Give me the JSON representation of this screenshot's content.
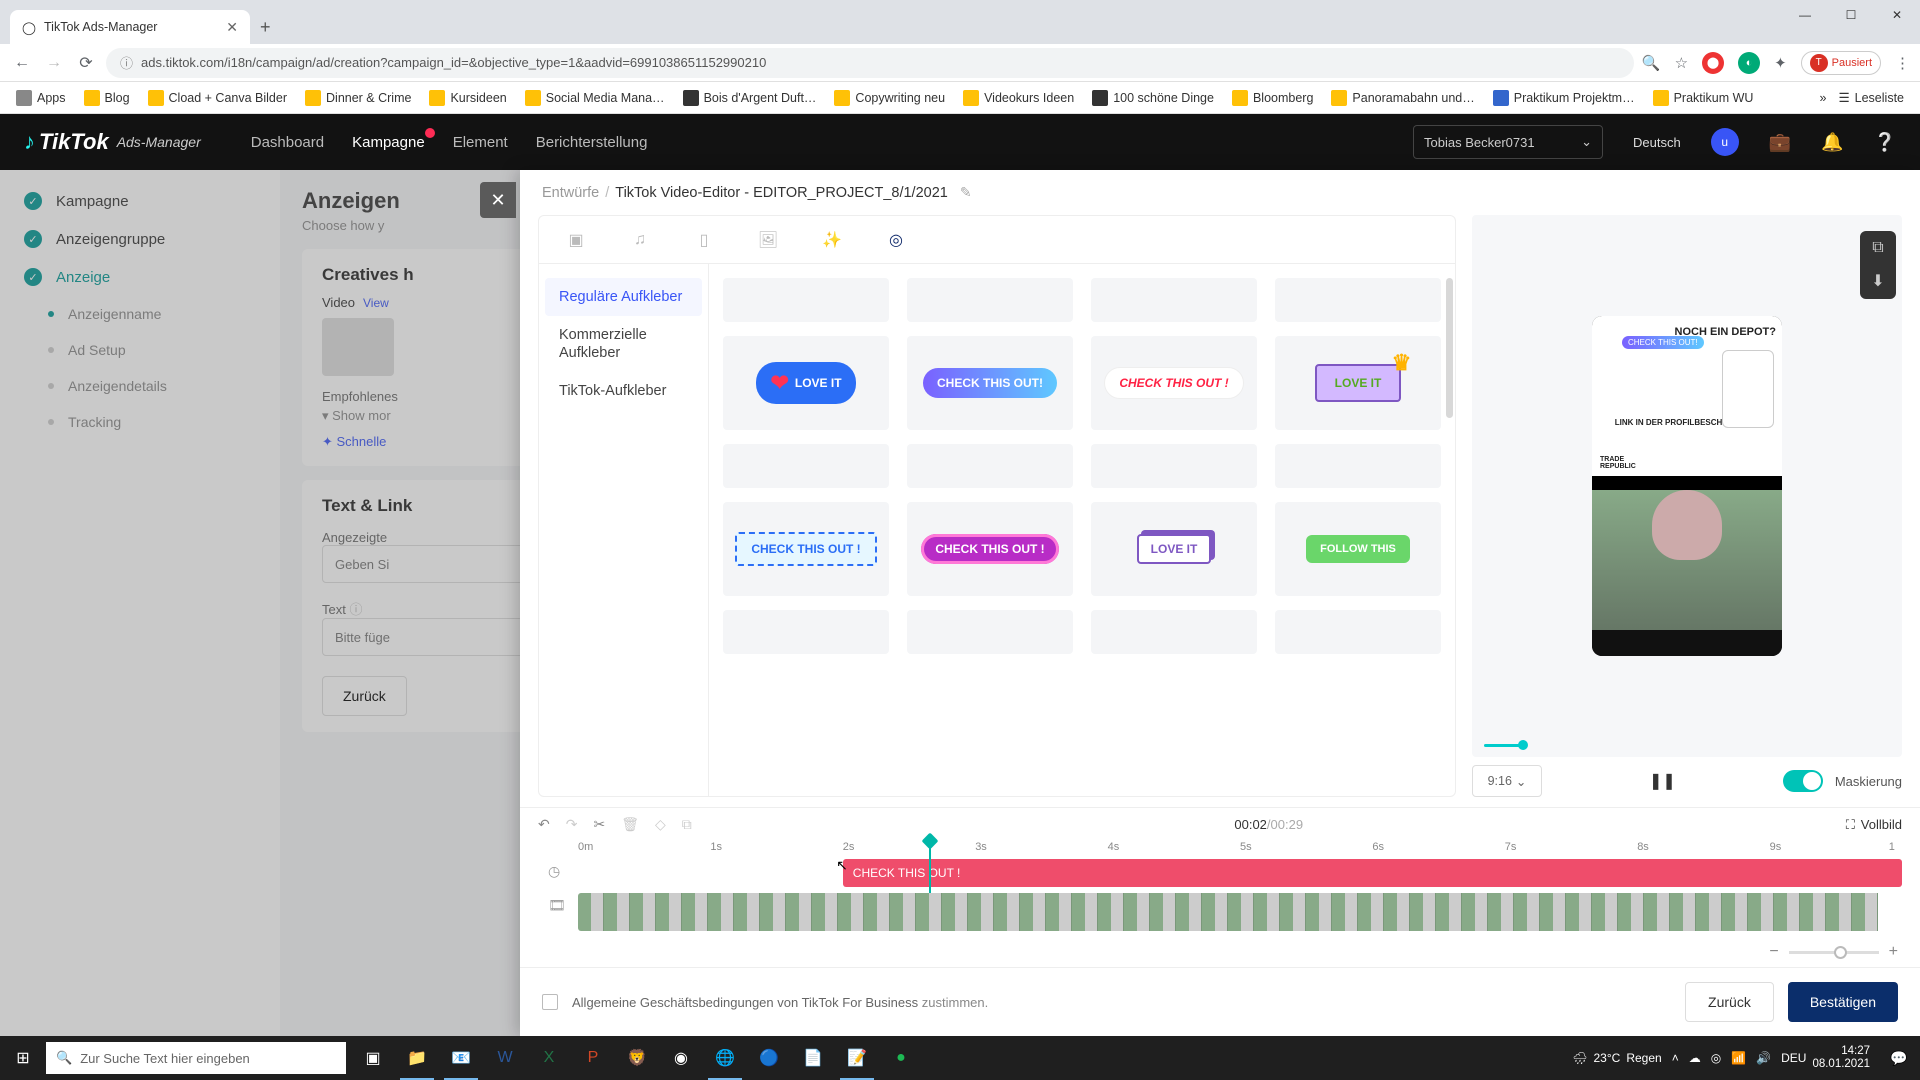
{
  "browser": {
    "tab_title": "TikTok Ads-Manager",
    "url": "ads.tiktok.com/i18n/campaign/ad/creation?campaign_id=&objective_type=1&aadvid=6991038651152990210",
    "pause_label": "Pausiert",
    "bookmarks": [
      "Apps",
      "Blog",
      "Cload + Canva Bilder",
      "Dinner & Crime",
      "Kursideen",
      "Social Media Mana…",
      "Bois d'Argent Duft…",
      "Copywriting neu",
      "Videokurs Ideen",
      "100 schöne Dinge",
      "Bloomberg",
      "Panoramabahn und…",
      "Praktikum Projektm…",
      "Praktikum WU"
    ],
    "reading_list": "Leseliste"
  },
  "header": {
    "brand": "TikTok",
    "brand_sub": "Ads-Manager",
    "nav": {
      "dashboard": "Dashboard",
      "kampagne": "Kampagne",
      "element": "Element",
      "bericht": "Berichterstellung"
    },
    "user": "Tobias Becker0731",
    "lang": "Deutsch",
    "avatar_letter": "u"
  },
  "ads_sidebar": {
    "items": [
      "Kampagne",
      "Anzeigengruppe",
      "Anzeige"
    ],
    "subs": [
      "Anzeigenname",
      "Ad Setup",
      "Anzeigendetails",
      "Tracking"
    ]
  },
  "ads_main": {
    "title": "Anzeigen",
    "subtitle": "Choose how y",
    "creatives_header": "Creatives h",
    "video_label": "Video",
    "view": "View",
    "empfohlenes": "Empfohlenes",
    "show_more": "Show mor",
    "schnelle": "Schnelle",
    "text_link": "Text & Link",
    "angezeigte": "Angezeigte",
    "angezeigte_ph": "Geben Si",
    "text_label": "Text",
    "text_ph": "Bitte füge",
    "back": "Zurück"
  },
  "editor": {
    "breadcrumb_root": "Entwürfe",
    "breadcrumb_title": "TikTok Video-Editor - EDITOR_PROJECT_8/1/2021",
    "cats": {
      "regular": "Reguläre Aufkleber",
      "commercial": "Kommerzielle Aufkleber",
      "tiktok": "TikTok-Aufkleber"
    },
    "stickers": {
      "loveit": "LOVE IT",
      "cto": "CHECK THIS OUT!",
      "cto_bang": "CHECK THIS OUT !",
      "follow": "FOLLOW THIS"
    },
    "preview": {
      "ratio": "9:16",
      "mask": "Maskierung",
      "phone_headline": "NOCH EIN DEPOT?",
      "phone_link": "LINK IN DER PROFILBESCHREIBUNG",
      "ov_sticker": "CHECK THIS OUT!"
    },
    "timeline": {
      "current": "00:02",
      "duration": "/00:29",
      "fullscreen": "Vollbild",
      "ticks": [
        "0m",
        "1s",
        "2s",
        "3s",
        "4s",
        "5s",
        "6s",
        "7s",
        "8s",
        "9s",
        "1"
      ],
      "sticker_clip": "CHECK THIS OUT !"
    },
    "footer": {
      "agb_pre": "Allgemeine Geschäftsbedingungen von TikTok For Business",
      "agb_link": "zustimmen.",
      "back": "Zurück",
      "confirm": "Bestätigen"
    }
  },
  "taskbar": {
    "search_ph": "Zur Suche Text hier eingeben",
    "weather_temp": "23°C",
    "weather_text": "Regen",
    "lang": "DEU",
    "time": "14:27",
    "date": "08.01.2021"
  }
}
